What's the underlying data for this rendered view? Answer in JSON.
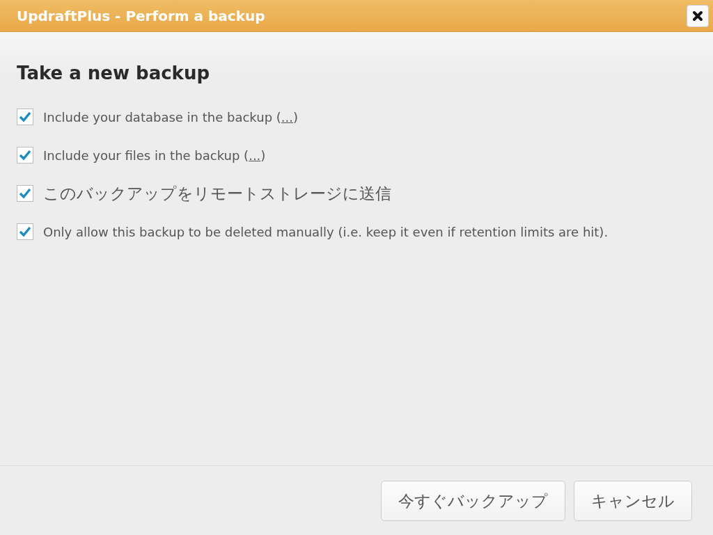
{
  "window": {
    "title": "UpdraftPlus - Perform a backup"
  },
  "heading": "Take a new backup",
  "options": [
    {
      "kind": "link",
      "text": "Include your database in the backup (",
      "link": "...",
      "after": ")",
      "checked": true
    },
    {
      "kind": "link",
      "text": "Include your files in the backup (",
      "link": "...",
      "after": ")",
      "checked": true
    },
    {
      "kind": "plain",
      "text": "このバックアップをリモートストレージに送信",
      "checked": true
    },
    {
      "kind": "plain",
      "text": "Only allow this backup to be deleted manually (i.e. keep it even if retention limits are hit).",
      "checked": true
    }
  ],
  "buttons": [
    "今すぐバックアップ",
    "キャンセル"
  ]
}
